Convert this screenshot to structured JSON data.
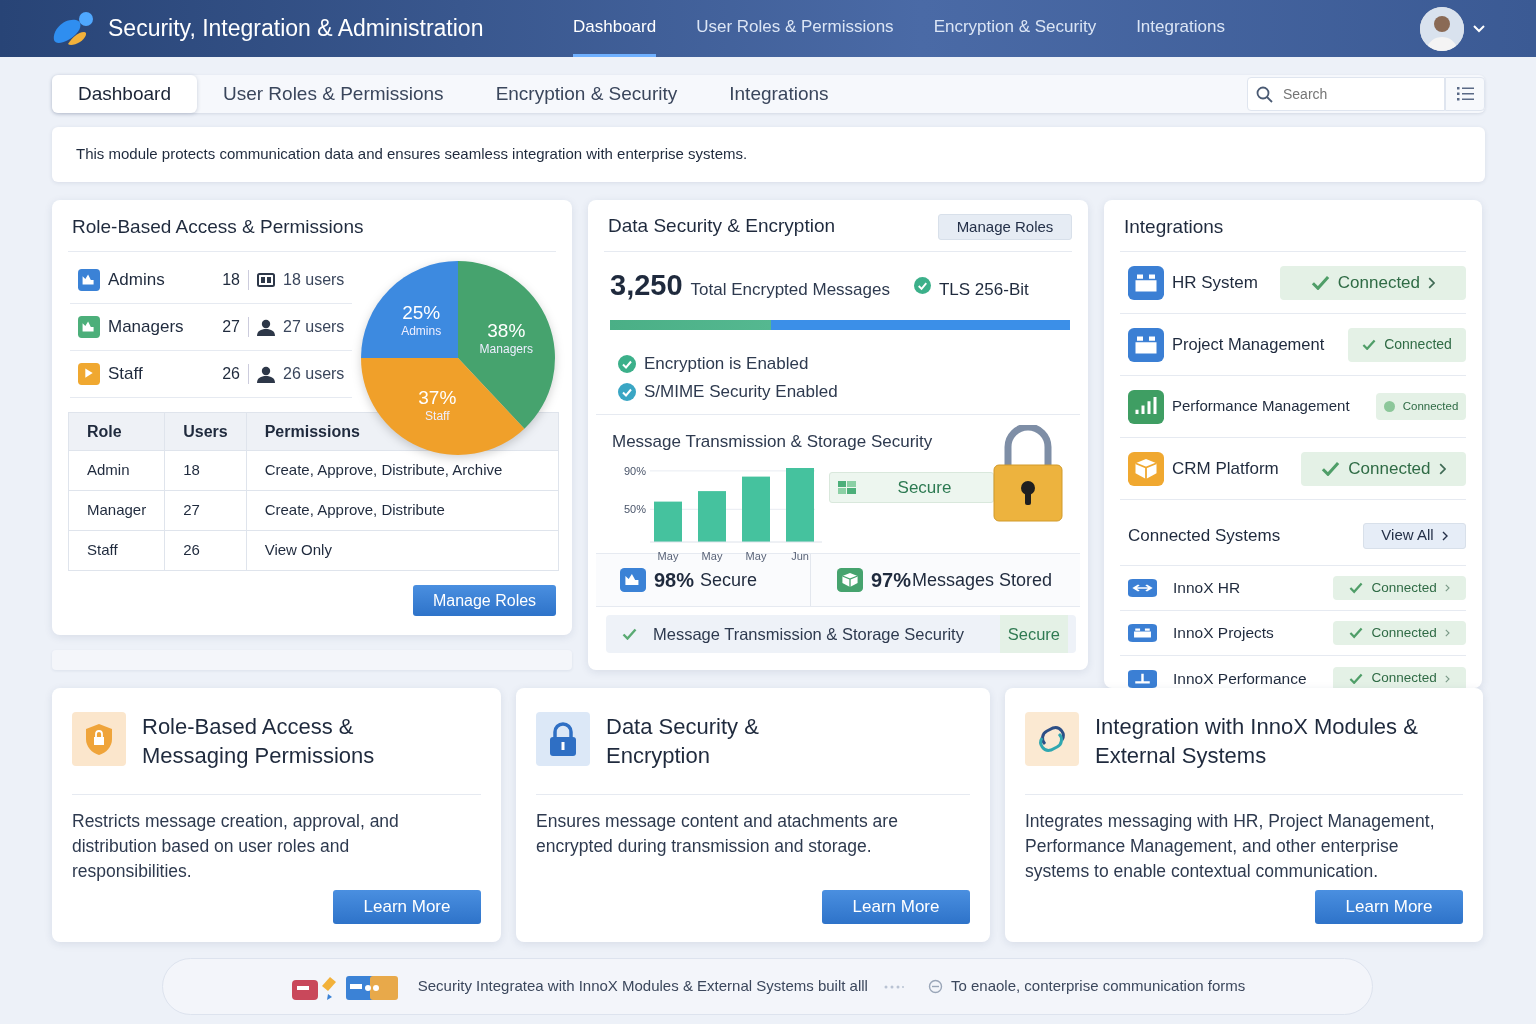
{
  "header": {
    "title": "Security, Integration & Administration",
    "tabs": [
      {
        "label": "Dashboard",
        "selected": true
      },
      {
        "label": "User Roles & Permissions",
        "selected": false
      },
      {
        "label": "Encryption & Security",
        "selected": false
      },
      {
        "label": "Integrations",
        "selected": false
      }
    ]
  },
  "subnav": {
    "tabs": [
      {
        "label": "Dashboard",
        "selected": true
      },
      {
        "label": "User Roles & Permissions",
        "selected": false
      },
      {
        "label": "Encryption & Security",
        "selected": false
      },
      {
        "label": "Integrations",
        "selected": false
      }
    ],
    "search": {
      "placeholder": "Search"
    }
  },
  "info": "This module protects communication data and ensures seamless integration with enterprise systems.",
  "roles_card": {
    "title": "Role-Based Access & Permissions",
    "roles": [
      {
        "name": "Admins",
        "count": "18",
        "users": "18 users",
        "color": "#3b82d6",
        "kind": "card"
      },
      {
        "name": "Managers",
        "count": "27",
        "users": "27 users",
        "color": "#4caf7a",
        "kind": "person"
      },
      {
        "name": "Staff",
        "count": "26",
        "users": "26 users",
        "color": "#f0a830",
        "kind": "person"
      }
    ],
    "chart_data": {
      "type": "pie",
      "categories": [
        "Admins",
        "Managers",
        "Staff"
      ],
      "values": [
        25,
        38,
        37
      ],
      "value_labels": [
        "25%",
        "38%",
        "37%"
      ]
    },
    "table": {
      "columns": [
        "Role",
        "Users",
        "Permissions"
      ],
      "rows": [
        [
          "Admin",
          "18",
          "Create, Approve, Distribute, Archive"
        ],
        [
          "Manager",
          "27",
          "Create, Approve, Distribute"
        ],
        [
          "Staff",
          "26",
          "View Only"
        ]
      ]
    },
    "button": "Manage Roles"
  },
  "security_card": {
    "title": "Data Security & Encryption",
    "button": "Manage Roles",
    "total": "3,250",
    "total_label": "Total Encrypted Messages",
    "tls": "TLS 256-Bit",
    "progress": {
      "level": 0.35
    },
    "checks": [
      "Encryption is Enabled",
      "S/MIME Security Enabled"
    ],
    "section_title": "Message Transmission & Storage Security",
    "chart_data": {
      "type": "bar",
      "categories": [
        "May",
        "May",
        "May",
        "Jun"
      ],
      "values": [
        58,
        69,
        84,
        93
      ],
      "ylim": [
        16,
        93
      ],
      "yticks": [
        {
          "value": 50,
          "label": "50%"
        },
        {
          "value": 90,
          "label": "90%"
        }
      ]
    },
    "secure_badge": "Secure",
    "stats": [
      {
        "value": "98%",
        "label": "Secure",
        "color": "#3b82d6"
      },
      {
        "value": "97%",
        "label": "Messages Stored",
        "color": "#46a36e"
      }
    ],
    "footer": {
      "text": "Message Transmission & Storage Security",
      "status": "Secure"
    }
  },
  "integrations_card": {
    "title": "Integrations",
    "items": [
      {
        "name": "HR System",
        "status": "Connected",
        "color": "#3b7fd4",
        "kind": "check",
        "arrow": true
      },
      {
        "name": "Project Management",
        "status": "Connected",
        "color": "#3b7fd4",
        "kind": "check",
        "arrow": false
      },
      {
        "name": "Performance Management",
        "status": "Connected",
        "color": "#3f9e63",
        "kind": "dot",
        "arrow": false
      },
      {
        "name": "CRM Platform",
        "status": "Connected",
        "color": "#f0a830",
        "kind": "check",
        "arrow": true
      }
    ],
    "systems_title": "Connected Systems",
    "view_all": "View All",
    "systems": [
      {
        "name": "InnoX HR",
        "status": "Connected"
      },
      {
        "name": "InnoX Projects",
        "status": "Connected"
      },
      {
        "name": "InnoX Performance",
        "status": "Connected"
      }
    ]
  },
  "feature_cards": [
    {
      "title": "Role-Based Access & Messaging Permissions",
      "text": "Restricts message creation, approval, and distribution based on user roles and responsibilities.",
      "button": "Learn More",
      "kind": "shield"
    },
    {
      "title": "Data Security & Encryption",
      "text": "Ensures message content and atachments are encrypted during transmission and storage.",
      "button": "Learn More",
      "kind": "lock"
    },
    {
      "title": "Integration with InnoX Modules & External Systems",
      "text": "Integrates messaging with HR, Project Management, Performance Management, and other enterprise systems to enable contextual communication.",
      "button": "Learn More",
      "kind": "link"
    }
  ],
  "footer": {
    "text": "Security Integratea with InnoX Modules & External Systems built alll",
    "note": "To enaole, conterprise communication forms"
  }
}
